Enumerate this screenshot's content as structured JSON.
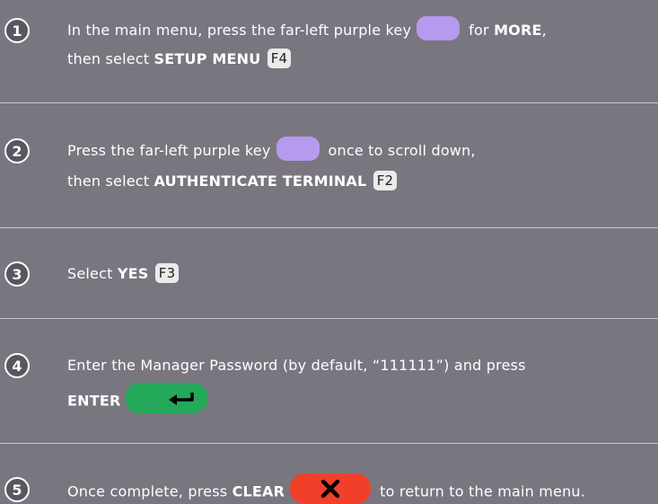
{
  "steps": [
    {
      "number": "1",
      "line1_pre": "In the main menu, press the far-left purple key",
      "line1_post": "for",
      "line1_bold": "MORE",
      "line1_end": ",",
      "line2_pre": "then select",
      "line2_bold": "SETUP MENU",
      "line2_fkey": "F4"
    },
    {
      "number": "2",
      "line1_pre": "Press the far-left purple key",
      "line1_post": "once to scroll down,",
      "line2_pre": "then select",
      "line2_bold": "AUTHENTICATE TERMINAL",
      "line2_fkey": "F2"
    },
    {
      "number": "3",
      "line1_pre": "Select",
      "line1_bold": "YES",
      "line1_fkey": "F3"
    },
    {
      "number": "4",
      "line1": "Enter the Manager Password (by default, “111111”) and press",
      "line2_bold": "ENTER"
    },
    {
      "number": "5",
      "line1_pre": "Once complete, press",
      "line1_bold": "CLEAR",
      "line1_post": "to return to the main menu."
    }
  ],
  "keys": {
    "purple_color": "#b59af0",
    "enter_color": "#24a85a",
    "clear_color": "#f0402a",
    "enter_icon": "return-arrow-icon",
    "clear_icon": "x-icon"
  }
}
